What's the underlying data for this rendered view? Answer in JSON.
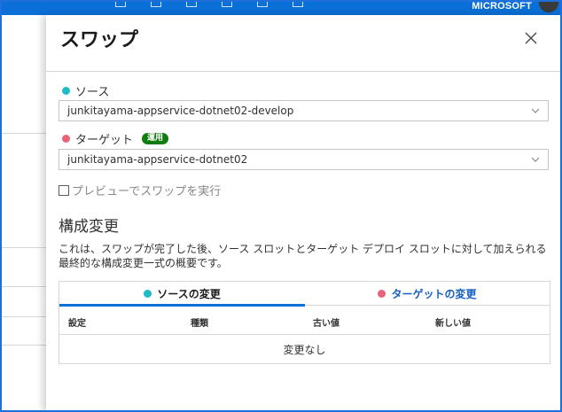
{
  "topbar": {
    "brand": "MICROSOFT",
    "bg_color": "#0a6fd6"
  },
  "panel": {
    "title": "スワップ",
    "close_icon": "close-icon"
  },
  "source": {
    "label": "ソース",
    "dot_color": "#1dbcc4",
    "value": "junkitayama-appservice-dotnet02-develop"
  },
  "target": {
    "label": "ターゲット",
    "badge": "運用",
    "dot_color": "#e8647a",
    "value": "junkitayama-appservice-dotnet02"
  },
  "preview": {
    "label": "プレビューでスワップを実行",
    "checked": false
  },
  "config": {
    "title": "構成変更",
    "description": "これは、スワップが完了した後、ソース スロットとターゲット デプロイ スロットに対して加えられる最終的な構成変更一式の概要です。"
  },
  "tabs": [
    {
      "label": "ソースの変更",
      "active": true,
      "dot_color": "#1dbcc4"
    },
    {
      "label": "ターゲットの変更",
      "active": false,
      "dot_color": "#e8647a"
    }
  ],
  "table": {
    "columns": [
      "設定",
      "種類",
      "古い値",
      "新しい値"
    ],
    "empty_text": "変更なし"
  }
}
